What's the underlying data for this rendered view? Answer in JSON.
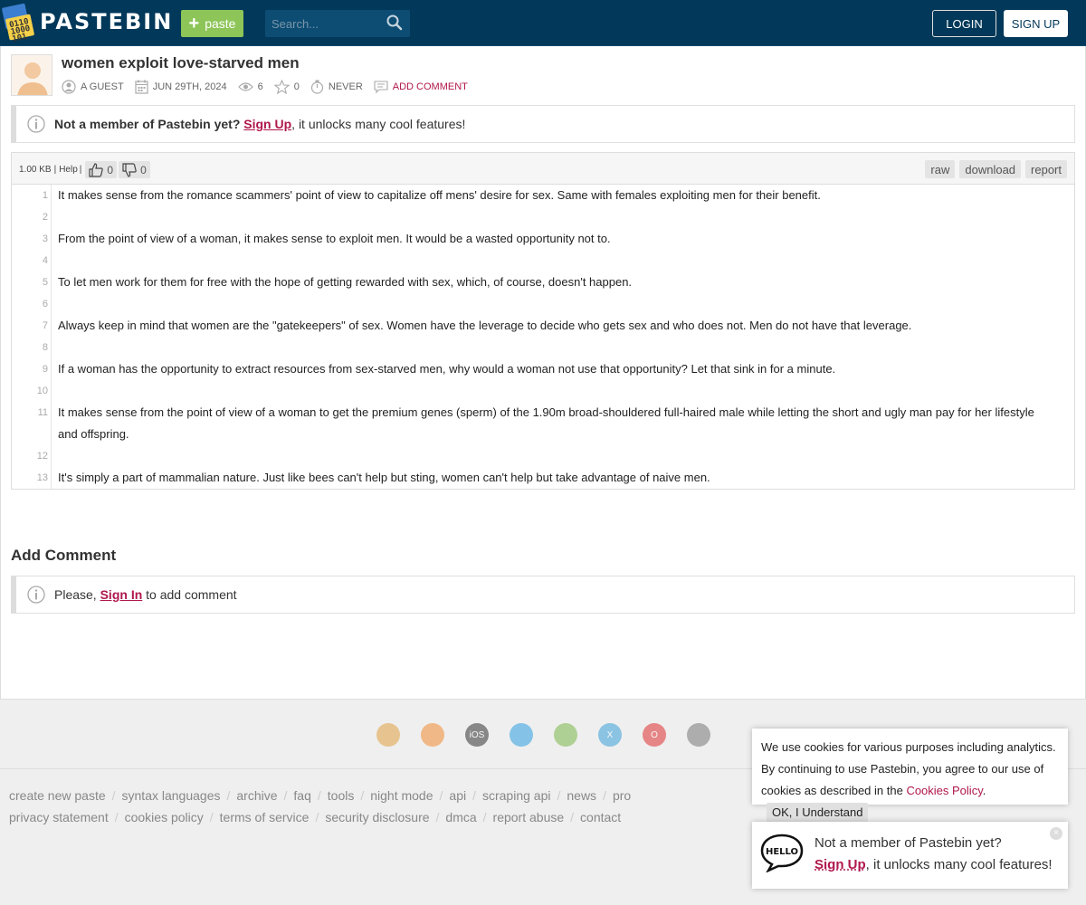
{
  "header": {
    "logo_text": "PASTEBIN",
    "logo_digits": "0110\n1000\n101",
    "paste_label": "paste",
    "search_placeholder": "Search...",
    "login_label": "LOGIN",
    "signup_label": "SIGN UP"
  },
  "paste": {
    "title": "women exploit love-starved men",
    "author": "A GUEST",
    "date": "JUN 29TH, 2024",
    "views": "6",
    "stars": "0",
    "expiry": "NEVER",
    "add_comment": "ADD COMMENT"
  },
  "notice_top": {
    "bold": "Not a member of Pastebin yet?",
    "link": "Sign Up",
    "rest": ", it unlocks many cool features!"
  },
  "code": {
    "size": "1.00 KB",
    "help": "Help",
    "sep": "|",
    "likes": "0",
    "dislikes": "0",
    "raw": "raw",
    "download": "download",
    "report": "report",
    "lines": [
      {
        "n": "1",
        "t": "It makes sense from the romance scammers' point of view to capitalize off mens' desire for sex. Same with females exploiting men for their benefit."
      },
      {
        "n": "2",
        "t": ""
      },
      {
        "n": "3",
        "t": "From the point of view of a woman, it makes sense to exploit men. It would be a wasted opportunity not to."
      },
      {
        "n": "4",
        "t": ""
      },
      {
        "n": "5",
        "t": "To let men work for them for free with the hope of getting rewarded with sex, which, of course, doesn't happen."
      },
      {
        "n": "6",
        "t": ""
      },
      {
        "n": "7",
        "t": "Always keep in mind that women are the \"gatekeepers\" of sex. Women have the leverage to decide who gets sex and who does not. Men do not have that leverage."
      },
      {
        "n": "8",
        "t": ""
      },
      {
        "n": "9",
        "t": "If a woman has the opportunity to extract resources from sex-starved men, why would a woman not use that opportunity? Let that sink in for a minute."
      },
      {
        "n": "10",
        "t": ""
      },
      {
        "n": "11",
        "t": "It makes sense from the point of view of a woman to get the premium genes (sperm) of the 1.90m broad-shouldered full-haired male while letting the short and ugly man pay for her lifestyle and offspring."
      },
      {
        "n": "12",
        "t": ""
      },
      {
        "n": "13",
        "t": "It's simply a part of mammalian nature. Just like bees can't help but sting, women can't help but take advantage of naive men."
      }
    ]
  },
  "comments": {
    "title": "Add Comment",
    "please": "Please, ",
    "sign_in": "Sign In",
    "rest": " to add comment"
  },
  "browser_icons": [
    {
      "name": "chrome-icon",
      "color": "#e0a040",
      "label": ""
    },
    {
      "name": "firefox-icon",
      "color": "#f08a30",
      "label": ""
    },
    {
      "name": "ios-icon",
      "color": "#333333",
      "label": "iOS"
    },
    {
      "name": "windows-icon",
      "color": "#2b9fe0",
      "label": ""
    },
    {
      "name": "android-icon",
      "color": "#7ab648",
      "label": ""
    },
    {
      "name": "x-icon",
      "color": "#3aa0d8",
      "label": "X"
    },
    {
      "name": "opera-icon",
      "color": "#e03030",
      "label": "O"
    },
    {
      "name": "linux-icon",
      "color": "#777777",
      "label": ""
    }
  ],
  "footer": {
    "row1": [
      "create new paste",
      "syntax languages",
      "archive",
      "faq",
      "tools",
      "night mode",
      "api",
      "scraping api",
      "news",
      "pro"
    ],
    "row2": [
      "privacy statement",
      "cookies policy",
      "terms of service",
      "security disclosure",
      "dmca",
      "report abuse",
      "contact"
    ]
  },
  "cookie": {
    "text": "We use cookies for various purposes including analytics. By continuing to use Pastebin, you agree to our use of cookies as described in the ",
    "link": "Cookies Policy",
    "period": ".",
    "ok": "OK, I Understand"
  },
  "hello": {
    "badge": "HELLO",
    "line1": "Not a member of Pastebin yet?",
    "link": "Sign Up",
    "rest": ", it unlocks many cool features!",
    "close": "×"
  }
}
